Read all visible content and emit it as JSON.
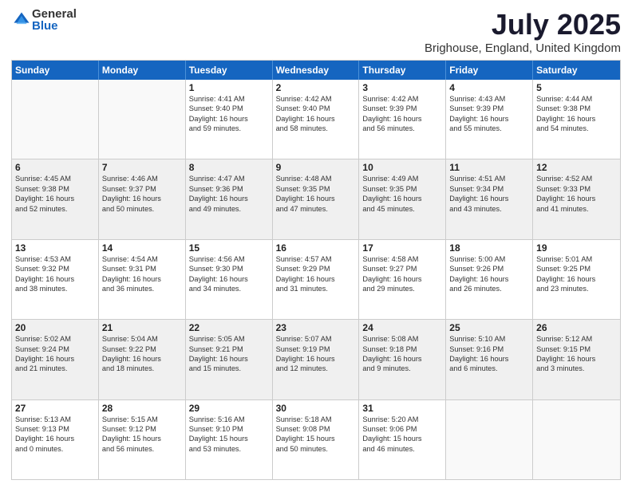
{
  "logo": {
    "general": "General",
    "blue": "Blue"
  },
  "header": {
    "title": "July 2025",
    "subtitle": "Brighouse, England, United Kingdom"
  },
  "days": [
    "Sunday",
    "Monday",
    "Tuesday",
    "Wednesday",
    "Thursday",
    "Friday",
    "Saturday"
  ],
  "weeks": [
    [
      {
        "day": "",
        "lines": []
      },
      {
        "day": "",
        "lines": []
      },
      {
        "day": "1",
        "lines": [
          "Sunrise: 4:41 AM",
          "Sunset: 9:40 PM",
          "Daylight: 16 hours",
          "and 59 minutes."
        ]
      },
      {
        "day": "2",
        "lines": [
          "Sunrise: 4:42 AM",
          "Sunset: 9:40 PM",
          "Daylight: 16 hours",
          "and 58 minutes."
        ]
      },
      {
        "day": "3",
        "lines": [
          "Sunrise: 4:42 AM",
          "Sunset: 9:39 PM",
          "Daylight: 16 hours",
          "and 56 minutes."
        ]
      },
      {
        "day": "4",
        "lines": [
          "Sunrise: 4:43 AM",
          "Sunset: 9:39 PM",
          "Daylight: 16 hours",
          "and 55 minutes."
        ]
      },
      {
        "day": "5",
        "lines": [
          "Sunrise: 4:44 AM",
          "Sunset: 9:38 PM",
          "Daylight: 16 hours",
          "and 54 minutes."
        ]
      }
    ],
    [
      {
        "day": "6",
        "lines": [
          "Sunrise: 4:45 AM",
          "Sunset: 9:38 PM",
          "Daylight: 16 hours",
          "and 52 minutes."
        ]
      },
      {
        "day": "7",
        "lines": [
          "Sunrise: 4:46 AM",
          "Sunset: 9:37 PM",
          "Daylight: 16 hours",
          "and 50 minutes."
        ]
      },
      {
        "day": "8",
        "lines": [
          "Sunrise: 4:47 AM",
          "Sunset: 9:36 PM",
          "Daylight: 16 hours",
          "and 49 minutes."
        ]
      },
      {
        "day": "9",
        "lines": [
          "Sunrise: 4:48 AM",
          "Sunset: 9:35 PM",
          "Daylight: 16 hours",
          "and 47 minutes."
        ]
      },
      {
        "day": "10",
        "lines": [
          "Sunrise: 4:49 AM",
          "Sunset: 9:35 PM",
          "Daylight: 16 hours",
          "and 45 minutes."
        ]
      },
      {
        "day": "11",
        "lines": [
          "Sunrise: 4:51 AM",
          "Sunset: 9:34 PM",
          "Daylight: 16 hours",
          "and 43 minutes."
        ]
      },
      {
        "day": "12",
        "lines": [
          "Sunrise: 4:52 AM",
          "Sunset: 9:33 PM",
          "Daylight: 16 hours",
          "and 41 minutes."
        ]
      }
    ],
    [
      {
        "day": "13",
        "lines": [
          "Sunrise: 4:53 AM",
          "Sunset: 9:32 PM",
          "Daylight: 16 hours",
          "and 38 minutes."
        ]
      },
      {
        "day": "14",
        "lines": [
          "Sunrise: 4:54 AM",
          "Sunset: 9:31 PM",
          "Daylight: 16 hours",
          "and 36 minutes."
        ]
      },
      {
        "day": "15",
        "lines": [
          "Sunrise: 4:56 AM",
          "Sunset: 9:30 PM",
          "Daylight: 16 hours",
          "and 34 minutes."
        ]
      },
      {
        "day": "16",
        "lines": [
          "Sunrise: 4:57 AM",
          "Sunset: 9:29 PM",
          "Daylight: 16 hours",
          "and 31 minutes."
        ]
      },
      {
        "day": "17",
        "lines": [
          "Sunrise: 4:58 AM",
          "Sunset: 9:27 PM",
          "Daylight: 16 hours",
          "and 29 minutes."
        ]
      },
      {
        "day": "18",
        "lines": [
          "Sunrise: 5:00 AM",
          "Sunset: 9:26 PM",
          "Daylight: 16 hours",
          "and 26 minutes."
        ]
      },
      {
        "day": "19",
        "lines": [
          "Sunrise: 5:01 AM",
          "Sunset: 9:25 PM",
          "Daylight: 16 hours",
          "and 23 minutes."
        ]
      }
    ],
    [
      {
        "day": "20",
        "lines": [
          "Sunrise: 5:02 AM",
          "Sunset: 9:24 PM",
          "Daylight: 16 hours",
          "and 21 minutes."
        ]
      },
      {
        "day": "21",
        "lines": [
          "Sunrise: 5:04 AM",
          "Sunset: 9:22 PM",
          "Daylight: 16 hours",
          "and 18 minutes."
        ]
      },
      {
        "day": "22",
        "lines": [
          "Sunrise: 5:05 AM",
          "Sunset: 9:21 PM",
          "Daylight: 16 hours",
          "and 15 minutes."
        ]
      },
      {
        "day": "23",
        "lines": [
          "Sunrise: 5:07 AM",
          "Sunset: 9:19 PM",
          "Daylight: 16 hours",
          "and 12 minutes."
        ]
      },
      {
        "day": "24",
        "lines": [
          "Sunrise: 5:08 AM",
          "Sunset: 9:18 PM",
          "Daylight: 16 hours",
          "and 9 minutes."
        ]
      },
      {
        "day": "25",
        "lines": [
          "Sunrise: 5:10 AM",
          "Sunset: 9:16 PM",
          "Daylight: 16 hours",
          "and 6 minutes."
        ]
      },
      {
        "day": "26",
        "lines": [
          "Sunrise: 5:12 AM",
          "Sunset: 9:15 PM",
          "Daylight: 16 hours",
          "and 3 minutes."
        ]
      }
    ],
    [
      {
        "day": "27",
        "lines": [
          "Sunrise: 5:13 AM",
          "Sunset: 9:13 PM",
          "Daylight: 16 hours",
          "and 0 minutes."
        ]
      },
      {
        "day": "28",
        "lines": [
          "Sunrise: 5:15 AM",
          "Sunset: 9:12 PM",
          "Daylight: 15 hours",
          "and 56 minutes."
        ]
      },
      {
        "day": "29",
        "lines": [
          "Sunrise: 5:16 AM",
          "Sunset: 9:10 PM",
          "Daylight: 15 hours",
          "and 53 minutes."
        ]
      },
      {
        "day": "30",
        "lines": [
          "Sunrise: 5:18 AM",
          "Sunset: 9:08 PM",
          "Daylight: 15 hours",
          "and 50 minutes."
        ]
      },
      {
        "day": "31",
        "lines": [
          "Sunrise: 5:20 AM",
          "Sunset: 9:06 PM",
          "Daylight: 15 hours",
          "and 46 minutes."
        ]
      },
      {
        "day": "",
        "lines": []
      },
      {
        "day": "",
        "lines": []
      }
    ]
  ]
}
